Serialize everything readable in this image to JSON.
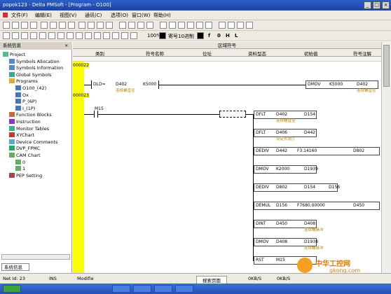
{
  "window": {
    "title": "popok123 - Delta PMSoft - [Program - O100]",
    "min": "_",
    "max": "□",
    "close": "×"
  },
  "menu": [
    "文件(F)",
    "编辑(E)",
    "视图(V)",
    "通讯(C)",
    "选项(O)",
    "窗口(W)",
    "帮助(H)"
  ],
  "toolbar2": {
    "zoom": "100%",
    "reg": "寄号10进制",
    "f": "f",
    "o": "0",
    "h": "H",
    "l": "L"
  },
  "left_panel": {
    "title": "系统信息",
    "close": "×",
    "tree": [
      {
        "label": "Project",
        "icon": "project-icon",
        "level": 0
      },
      {
        "label": "Symbols Allocation",
        "icon": "symbols-icon",
        "level": 1
      },
      {
        "label": "Symbols Information",
        "icon": "symbols-icon",
        "level": 1
      },
      {
        "label": "Global Symbols",
        "icon": "globe-icon",
        "level": 1
      },
      {
        "label": "Programs",
        "icon": "folder-icon",
        "level": 1
      },
      {
        "label": "O100_(42)",
        "icon": "program-icon",
        "level": 2
      },
      {
        "label": "Ox",
        "icon": "program-icon",
        "level": 2
      },
      {
        "label": "P_(6P)",
        "icon": "program-icon",
        "level": 2
      },
      {
        "label": "I_(1P)",
        "icon": "program-icon",
        "level": 2
      },
      {
        "label": "Function Blocks",
        "icon": "block-icon",
        "level": 1
      },
      {
        "label": "Instruction",
        "icon": "instruction-icon",
        "level": 1
      },
      {
        "label": "Monitor Tables",
        "icon": "table-icon",
        "level": 1
      },
      {
        "label": "XYChart",
        "icon": "chart-icon",
        "level": 1
      },
      {
        "label": "Device Comments",
        "icon": "comment-icon",
        "level": 1
      },
      {
        "label": "DVP_FPMC",
        "icon": "device-icon",
        "level": 1
      },
      {
        "label": "CAM Chart",
        "icon": "cam-icon",
        "level": 1
      },
      {
        "label": "0",
        "icon": "cam-icon",
        "level": 2
      },
      {
        "label": "1",
        "icon": "cam-icon",
        "level": 2
      },
      {
        "label": "PEP Setting",
        "icon": "settings-icon",
        "level": 1
      }
    ],
    "tab": "系统信息"
  },
  "editor": {
    "header": "区域符号",
    "columns": [
      "类别",
      "符号名称",
      "位址",
      "资料型态",
      "初始值",
      "符号注解"
    ],
    "rungs": [
      {
        "step": "000022",
        "step2": "000023"
      },
      {
        "contact1": "M15"
      }
    ],
    "instr": {
      "dld": "DLD=",
      "dld_a": "D402",
      "dld_b": "K5000",
      "dld_cmt": "连续螺直径",
      "dmov_top": "DMOV",
      "dmov_top_a": "K5000",
      "dmov_top_b": "D402",
      "dmov_top_cmt": "连续螺直径",
      "dflt1": "DFLT",
      "dflt1_a": "D402",
      "dflt1_b": "D154",
      "dflt1_cmt": "连续螺直径",
      "dflt2": "DFLT",
      "dflt2_a": "D406",
      "dflt2_b": "D442",
      "dflt2_cmt": "设定长度()",
      "dediv1": "DEDIV",
      "dediv1_a": "D442",
      "dediv1_b": "F3.14160",
      "dediv1_c": "D802",
      "dmov2": "DMOV",
      "dmov2_a": "K2000",
      "dmov2_b": "D1939",
      "dediv2": "DEDIV",
      "dediv2_a": "D802",
      "dediv2_b": "D154",
      "dediv2_c": "D156",
      "demul": "DEMUL",
      "demul_a": "D156",
      "demul_b": "F7680.00000",
      "demul_c": "D450",
      "dint": "DINT",
      "dint_a": "D450",
      "dint_b": "D408",
      "dint_cmt": "连续螺脉冲",
      "dmov3": "DMOV",
      "dmov3_a": "D408",
      "dmov3_b": "D1938",
      "dmov3_cmt": "连续螺脉冲",
      "rst": "RST",
      "rst_a": "M15"
    }
  },
  "status": {
    "net": "Net Id: 23",
    "ins": "INS",
    "modified": "Modifie",
    "input": "搜索页面",
    "speed1": "0KB/S",
    "speed2": "0KB/S"
  },
  "watermark": {
    "text": "中华工控网",
    "url": "gkong.com"
  },
  "colors": {
    "rail": "#ffff00",
    "comment": "#b8860b",
    "title": "#2d5fc9"
  }
}
